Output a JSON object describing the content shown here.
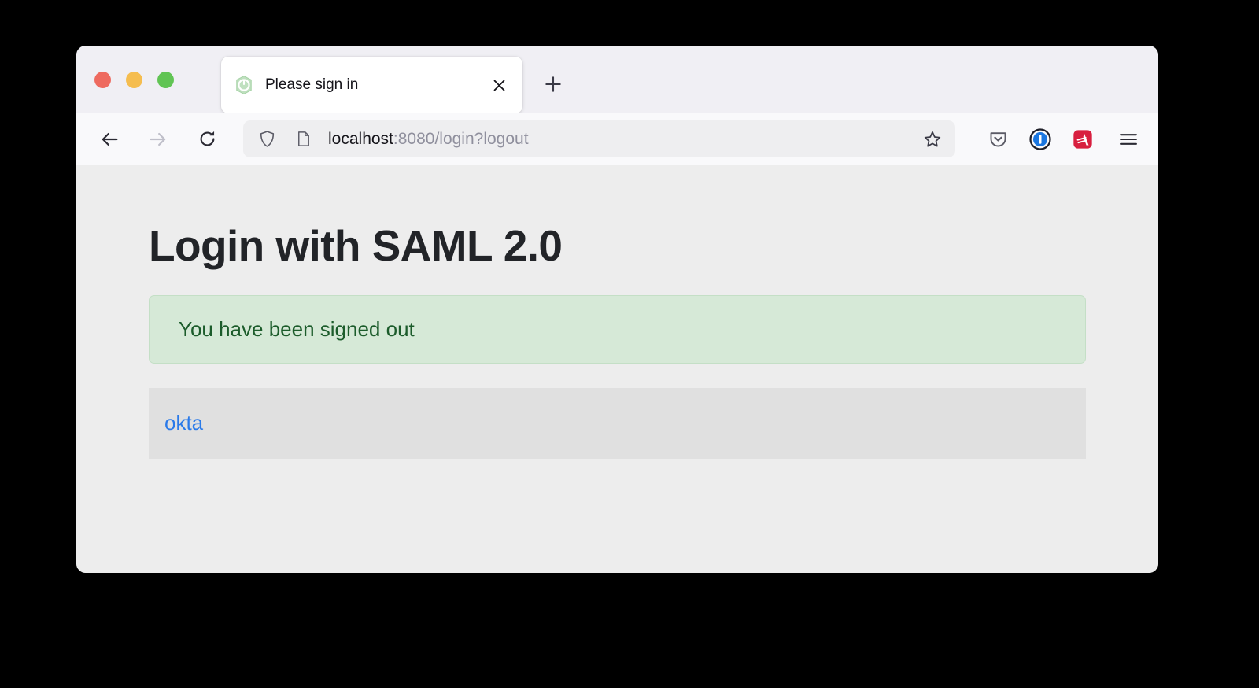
{
  "browser": {
    "window_controls": [
      {
        "name": "close",
        "color": "#ee6a5f"
      },
      {
        "name": "minimize",
        "color": "#f5bd4f"
      },
      {
        "name": "maximize",
        "color": "#61c454"
      }
    ],
    "tabs": [
      {
        "title": "Please sign in",
        "favicon": "spring-boot-leaf-icon",
        "active": true,
        "close_label": "×"
      }
    ],
    "new_tab_label": "+",
    "nav": {
      "back": "back-arrow-icon",
      "forward": "forward-arrow-icon",
      "reload": "reload-icon"
    },
    "urlbar": {
      "shield_icon": "tracking-protection-shield-icon",
      "page_icon": "page-document-icon",
      "host": "localhost",
      "path": ":8080/login?logout",
      "full_url": "localhost:8080/login?logout",
      "bookmark_icon": "star-outline-icon"
    },
    "extensions": [
      {
        "name": "pocket-icon",
        "title": "Pocket"
      },
      {
        "name": "1password-icon",
        "title": "1Password"
      },
      {
        "name": "adobe-acrobat-icon",
        "title": "Adobe Acrobat"
      }
    ],
    "menu_icon": "hamburger-menu-icon"
  },
  "page": {
    "title": "Login with SAML 2.0",
    "alert": {
      "message": "You have been signed out",
      "background": "#d6e9d7",
      "text_color": "#1c5c2b"
    },
    "providers": {
      "background": "#e0e0e0",
      "items": [
        {
          "label": "okta",
          "color": "#2a7ae9"
        }
      ]
    }
  }
}
